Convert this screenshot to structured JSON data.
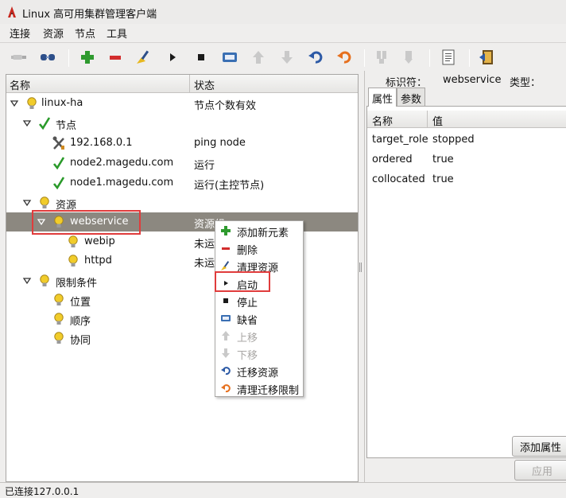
{
  "window": {
    "title": "Linux 高可用集群管理客户端"
  },
  "menubar": {
    "items": [
      "连接",
      "资源",
      "节点",
      "工具"
    ]
  },
  "tree": {
    "columns": {
      "name": "名称",
      "status": "状态"
    },
    "rows": [
      {
        "label": "linux-ha",
        "status": "节点个数有效",
        "icon": "bulb-icon"
      },
      {
        "label": "节点",
        "status": "",
        "icon": "check-icon"
      },
      {
        "label": "192.168.0.1",
        "status": "ping node",
        "icon": "tools-icon"
      },
      {
        "label": "node2.magedu.com",
        "status": "运行",
        "icon": "check-icon"
      },
      {
        "label": "node1.magedu.com",
        "status": "运行(主控节点)",
        "icon": "check-icon"
      },
      {
        "label": "资源",
        "status": "",
        "icon": "bulb-icon"
      },
      {
        "label": "webservice",
        "status": "资源组",
        "icon": "bulb-icon"
      },
      {
        "label": "webip",
        "status": "未运",
        "icon": "bulb-icon"
      },
      {
        "label": "httpd",
        "status": "未运",
        "icon": "bulb-icon"
      },
      {
        "label": "限制条件",
        "status": "",
        "icon": "bulb-icon"
      },
      {
        "label": "位置",
        "status": "",
        "icon": "bulb-icon"
      },
      {
        "label": "顺序",
        "status": "",
        "icon": "bulb-icon"
      },
      {
        "label": "协同",
        "status": "",
        "icon": "bulb-icon"
      }
    ]
  },
  "details": {
    "identifier_label": "标识符：",
    "identifier_value": "webservice",
    "type_label": "类型：",
    "tabs": [
      "属性",
      "参数"
    ],
    "columns": {
      "name": "名称",
      "value": "值"
    },
    "properties": [
      {
        "name": "target_role",
        "value": "stopped"
      },
      {
        "name": "ordered",
        "value": "true"
      },
      {
        "name": "collocated",
        "value": "true"
      }
    ],
    "add_button": "添加属性",
    "apply_button": "应用"
  },
  "context_menu": {
    "items": [
      {
        "label": "添加新元素",
        "icon": "plus-icon",
        "enabled": true
      },
      {
        "label": "删除",
        "icon": "minus-icon",
        "enabled": true
      },
      {
        "label": "清理资源",
        "icon": "broom-icon",
        "enabled": true
      },
      {
        "label": "启动",
        "icon": "play-icon",
        "enabled": true
      },
      {
        "label": "停止",
        "icon": "stop-icon",
        "enabled": true
      },
      {
        "label": "缺省",
        "icon": "default-icon",
        "enabled": true
      },
      {
        "label": "上移",
        "icon": "arrow-up-icon",
        "enabled": false
      },
      {
        "label": "下移",
        "icon": "arrow-down-icon",
        "enabled": false
      },
      {
        "label": "迁移资源",
        "icon": "migrate-icon",
        "enabled": true
      },
      {
        "label": "清理迁移限制",
        "icon": "unmigrate-icon",
        "enabled": true
      }
    ]
  },
  "status": {
    "text": "已连接127.0.0.1"
  },
  "colors": {
    "highlight": "#e03c3c",
    "selection": "#8c8880"
  }
}
